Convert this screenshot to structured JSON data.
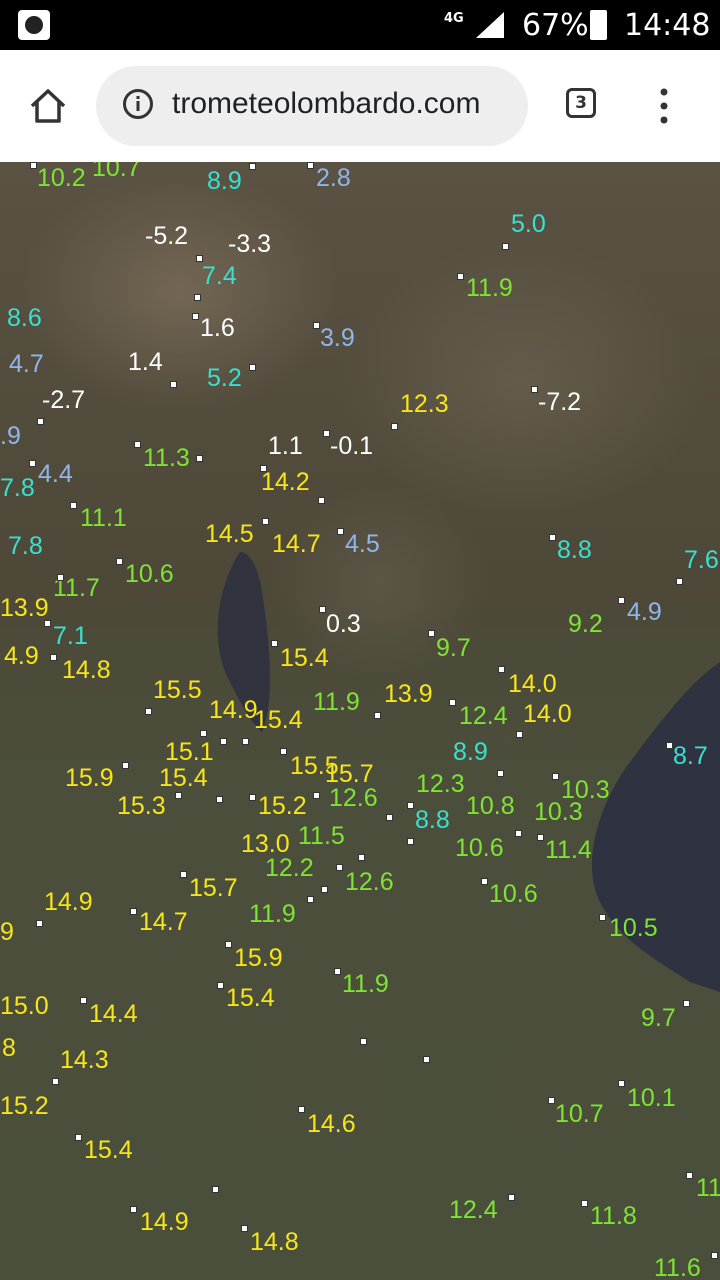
{
  "status_bar": {
    "network": "4G",
    "battery": "67%",
    "time": "14:48"
  },
  "browser": {
    "url": "trometeolombardo.com",
    "tab_count": "3"
  },
  "map": {
    "colors": {
      "white": "#ffffff",
      "blue": "#8fb6ec",
      "cyan": "#38e0d0",
      "green": "#7fe334",
      "yellow": "#f7e51c"
    },
    "labels": [
      {
        "text": "10.2",
        "c": "green"
      },
      {
        "text": "10.7",
        "c": "green"
      },
      {
        "text": "8.9",
        "c": "cyan"
      },
      {
        "text": "2.8",
        "c": "blue"
      },
      {
        "text": "-5.2",
        "c": "white"
      },
      {
        "text": "-3.3",
        "c": "white"
      },
      {
        "text": "5.0",
        "c": "cyan"
      },
      {
        "text": "7.4",
        "c": "cyan"
      },
      {
        "text": "11.9",
        "c": "green"
      },
      {
        "text": "8.6",
        "c": "cyan"
      },
      {
        "text": "1.6",
        "c": "white"
      },
      {
        "text": "3.9",
        "c": "blue"
      },
      {
        "text": "4.7",
        "c": "blue"
      },
      {
        "text": "1.4",
        "c": "white"
      },
      {
        "text": "5.2",
        "c": "cyan"
      },
      {
        "text": "-2.7",
        "c": "white"
      },
      {
        "text": "12.3",
        "c": "yellow"
      },
      {
        "text": "-7.2",
        "c": "white"
      },
      {
        "text": ".9",
        "c": "blue"
      },
      {
        "text": "1.1",
        "c": "white"
      },
      {
        "text": "-0.1",
        "c": "white"
      },
      {
        "text": "11.3",
        "c": "green"
      },
      {
        "text": "7.8",
        "c": "cyan"
      },
      {
        "text": "4.4",
        "c": "blue"
      },
      {
        "text": "14.2",
        "c": "yellow"
      },
      {
        "text": "11.1",
        "c": "green"
      },
      {
        "text": "14.5",
        "c": "yellow"
      },
      {
        "text": "14.7",
        "c": "yellow"
      },
      {
        "text": "4.5",
        "c": "blue"
      },
      {
        "text": "7.8",
        "c": "cyan"
      },
      {
        "text": "8.8",
        "c": "cyan"
      },
      {
        "text": "7.6",
        "c": "cyan"
      },
      {
        "text": "10.6",
        "c": "green"
      },
      {
        "text": "11.7",
        "c": "green"
      },
      {
        "text": "13.9",
        "c": "yellow"
      },
      {
        "text": "9.2",
        "c": "green"
      },
      {
        "text": "4.9",
        "c": "blue"
      },
      {
        "text": "7.1",
        "c": "cyan"
      },
      {
        "text": "0.3",
        "c": "white"
      },
      {
        "text": "9.7",
        "c": "green"
      },
      {
        "text": "4.9",
        "c": "yellow"
      },
      {
        "text": "14.8",
        "c": "yellow"
      },
      {
        "text": "15.4",
        "c": "yellow"
      },
      {
        "text": "14.0",
        "c": "yellow"
      },
      {
        "text": "15.5",
        "c": "yellow"
      },
      {
        "text": "11.9",
        "c": "green"
      },
      {
        "text": "13.9",
        "c": "yellow"
      },
      {
        "text": "14.9",
        "c": "yellow"
      },
      {
        "text": "12.4",
        "c": "green"
      },
      {
        "text": "14.0",
        "c": "yellow"
      },
      {
        "text": "15.4",
        "c": "yellow"
      },
      {
        "text": "8.7",
        "c": "cyan"
      },
      {
        "text": "15.1",
        "c": "yellow"
      },
      {
        "text": "8.9",
        "c": "cyan"
      },
      {
        "text": "15.9",
        "c": "yellow"
      },
      {
        "text": "15.4",
        "c": "yellow"
      },
      {
        "text": "15.5",
        "c": "yellow"
      },
      {
        "text": "15.7",
        "c": "yellow"
      },
      {
        "text": "12.3",
        "c": "green"
      },
      {
        "text": "10.3",
        "c": "green"
      },
      {
        "text": "15.3",
        "c": "yellow"
      },
      {
        "text": "15.2",
        "c": "yellow"
      },
      {
        "text": "12.6",
        "c": "green"
      },
      {
        "text": "10.8",
        "c": "green"
      },
      {
        "text": "10.3",
        "c": "green"
      },
      {
        "text": "8.8",
        "c": "cyan"
      },
      {
        "text": "13.0",
        "c": "yellow"
      },
      {
        "text": "11.5",
        "c": "green"
      },
      {
        "text": "10.6",
        "c": "green"
      },
      {
        "text": "11.4",
        "c": "green"
      },
      {
        "text": "12.2",
        "c": "green"
      },
      {
        "text": "12.6",
        "c": "green"
      },
      {
        "text": "15.7",
        "c": "yellow"
      },
      {
        "text": "10.6",
        "c": "green"
      },
      {
        "text": "14.9",
        "c": "yellow"
      },
      {
        "text": "9",
        "c": "yellow"
      },
      {
        "text": "14.7",
        "c": "yellow"
      },
      {
        "text": "11.9",
        "c": "green"
      },
      {
        "text": "10.5",
        "c": "green"
      },
      {
        "text": "15.9",
        "c": "yellow"
      },
      {
        "text": "11.9",
        "c": "green"
      },
      {
        "text": "15.4",
        "c": "yellow"
      },
      {
        "text": "15.0",
        "c": "yellow"
      },
      {
        "text": "14.4",
        "c": "yellow"
      },
      {
        "text": "9.7",
        "c": "green"
      },
      {
        "text": "8",
        "c": "yellow"
      },
      {
        "text": "14.3",
        "c": "yellow"
      },
      {
        "text": "10.1",
        "c": "green"
      },
      {
        "text": "15.2",
        "c": "yellow"
      },
      {
        "text": "10.7",
        "c": "green"
      },
      {
        "text": "14.6",
        "c": "yellow"
      },
      {
        "text": "15.4",
        "c": "yellow"
      },
      {
        "text": "11",
        "c": "green"
      },
      {
        "text": "12.4",
        "c": "green"
      },
      {
        "text": "11.8",
        "c": "green"
      },
      {
        "text": "14.9",
        "c": "yellow"
      },
      {
        "text": "14.8",
        "c": "yellow"
      },
      {
        "text": "11.6",
        "c": "green"
      }
    ]
  }
}
